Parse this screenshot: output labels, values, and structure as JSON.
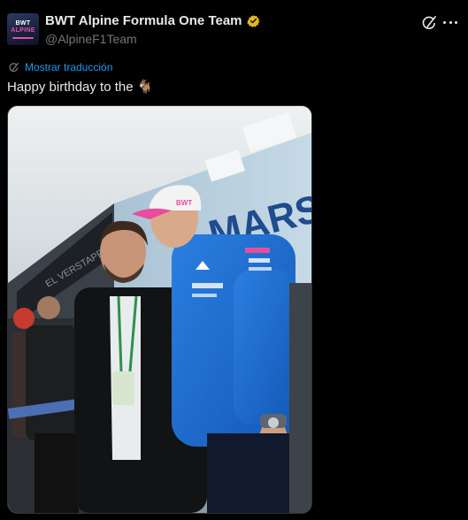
{
  "author": {
    "display_name": "BWT Alpine Formula One Team",
    "handle": "@AlpineF1Team",
    "verified": true,
    "badge_color": "#e2b719",
    "avatar_icon": "bwt-alpine-logo"
  },
  "actions": {
    "grok_icon": "grok-icon",
    "more_icon": "more-icon"
  },
  "translate": {
    "label": "Mostrar traducción",
    "icon": "translate-icon"
  },
  "tweet": {
    "text": "Happy birthday to the",
    "emoji": "🐐"
  },
  "media": {
    "wall_text": "MARS",
    "cap_text": "BWT",
    "alt": ""
  },
  "colors": {
    "link": "#1d9bf0",
    "muted": "#71767b",
    "text": "#e7e9ea",
    "background": "#000000"
  }
}
